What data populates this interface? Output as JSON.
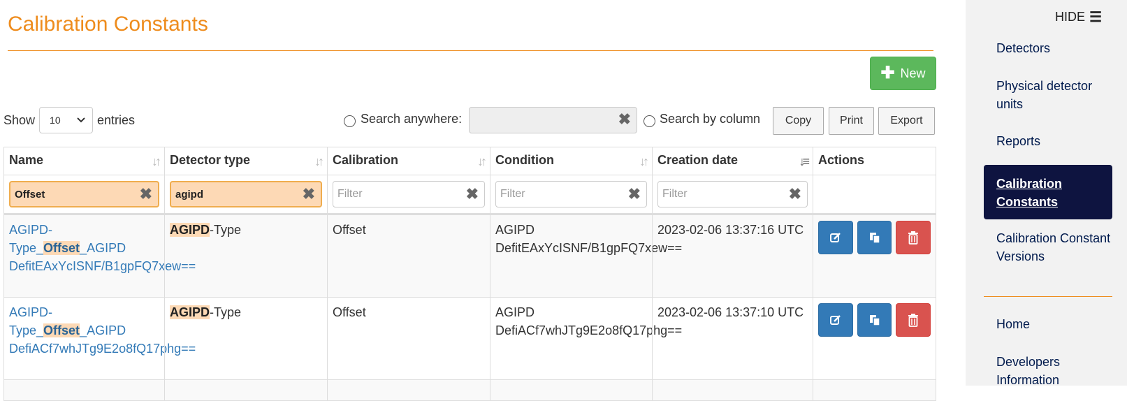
{
  "page": {
    "title": "Calibration Constants"
  },
  "toolbar": {
    "new_label": "New",
    "show_label": "Show",
    "entries_label": "entries",
    "page_length": "10",
    "search_anywhere_label": "Search anywhere:",
    "search_anywhere_value": "",
    "search_by_column_label": "Search by column",
    "copy_label": "Copy",
    "print_label": "Print",
    "export_label": "Export"
  },
  "table": {
    "headers": [
      "Name",
      "Detector type",
      "Calibration",
      "Condition",
      "Creation date",
      "Actions"
    ],
    "filters": [
      {
        "value": "Offset",
        "placeholder": "Filter"
      },
      {
        "value": "agipd",
        "placeholder": "Filter"
      },
      {
        "value": "",
        "placeholder": "Filter"
      },
      {
        "value": "",
        "placeholder": "Filter"
      },
      {
        "value": "",
        "placeholder": "Filter"
      }
    ],
    "rows": [
      {
        "name_prefix": "AGIPD-Type_",
        "name_highlight": "Offset",
        "name_suffix": "_AGIPD DefitEAxYcISNF/B1gpFQ7xew==",
        "detector_highlight": "AGIPD",
        "detector_suffix": "-Type",
        "calibration": "Offset",
        "condition": "AGIPD DefitEAxYcISNF/B1gpFQ7xew==",
        "creation_date": "2023-02-06 13:37:16 UTC"
      },
      {
        "name_prefix": "AGIPD-Type_",
        "name_highlight": "Offset",
        "name_suffix": "_AGIPD DefiACf7whJTg9E2o8fQ17phg==",
        "detector_highlight": "AGIPD",
        "detector_suffix": "-Type",
        "calibration": "Offset",
        "condition": "AGIPD DefiACf7whJTg9E2o8fQ17phg==",
        "creation_date": "2023-02-06 13:37:10 UTC"
      }
    ]
  },
  "sidebar": {
    "hide_label": "HIDE",
    "items": [
      {
        "label": "Detectors",
        "active": false
      },
      {
        "label": "Physical detector units",
        "active": false
      },
      {
        "label": "Reports",
        "active": false
      },
      {
        "label": "Calibration Constants",
        "active": true
      },
      {
        "label": "Calibration Constant Versions",
        "active": false
      },
      {
        "label": "Home",
        "active": false
      },
      {
        "label": "Developers Information",
        "active": false
      }
    ]
  },
  "colors": {
    "accent_orange": "#ee8c1d",
    "success_green": "#5cb85c",
    "primary_blue": "#337ab7",
    "danger_red": "#d9534f",
    "sidebar_active_navy": "#0e1440",
    "highlight": "#fdd9b5"
  },
  "icons": {
    "new": "plus-icon",
    "clear": "times-icon",
    "edit": "edit-icon",
    "clone": "copy-icon",
    "delete": "trash-icon",
    "sort": "sort-icon",
    "sort_active": "sort-desc-icon",
    "menu": "bars-icon"
  }
}
